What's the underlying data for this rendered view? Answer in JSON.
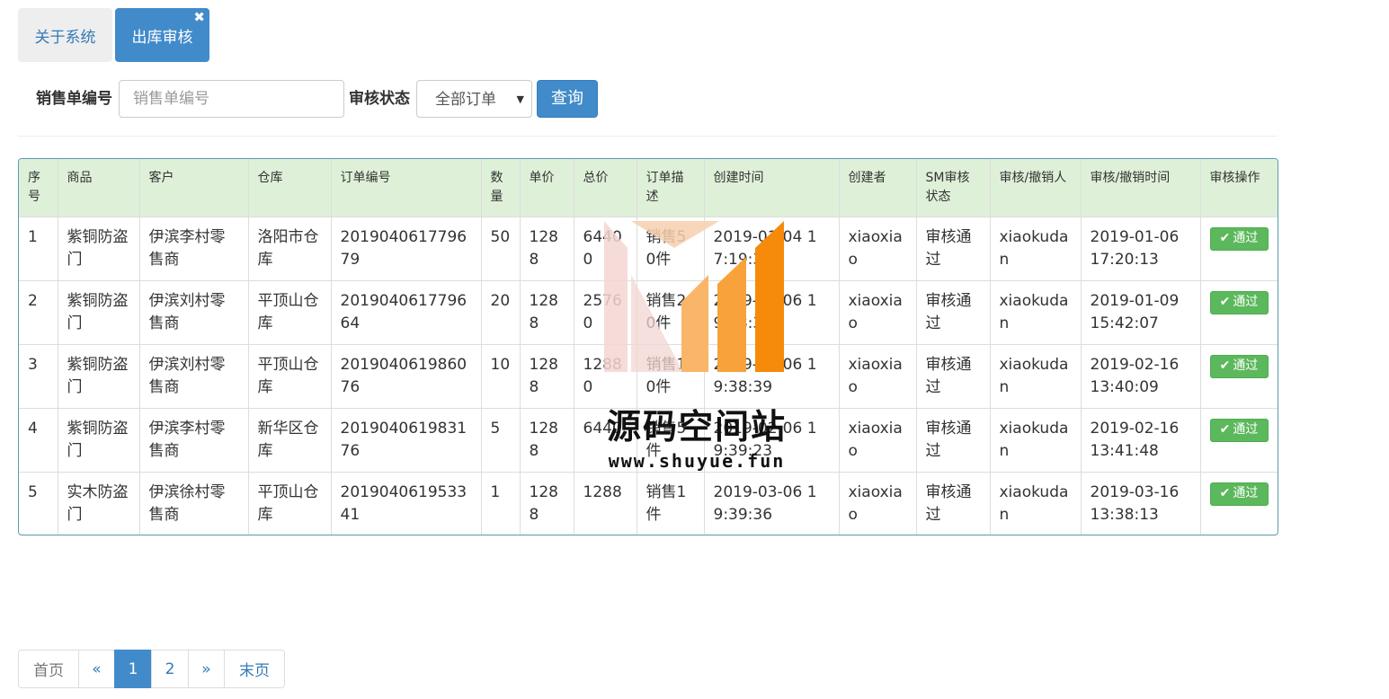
{
  "tabs": {
    "about": "关于系统",
    "active": "出库审核",
    "close": "✖"
  },
  "search": {
    "order_label": "销售单编号",
    "order_placeholder": "销售单编号",
    "status_label": "审核状态",
    "status_selected": "全部订单",
    "query_button": "查询"
  },
  "table": {
    "headers": [
      "序号",
      "商品",
      "客户",
      "仓库",
      "订单编号",
      "数量",
      "单价",
      "总价",
      "订单描述",
      "创建时间",
      "创建者",
      "SM审核状态",
      "审核/撤销人",
      "审核/撤销时间",
      "审核操作"
    ],
    "rows": [
      [
        "1",
        "紫铜防盗门",
        "伊滨李村零售商",
        "洛阳市仓库",
        "201904061779679",
        "50",
        "1288",
        "64400",
        "销售50件",
        "2019-01-04 17:19:39",
        "xiaoxiao",
        "审核通过",
        "xiaokudan",
        "2019-01-06 17:20:13"
      ],
      [
        "2",
        "紫铜防盗门",
        "伊滨刘村零售商",
        "平顶山仓库",
        "201904061779664",
        "20",
        "1288",
        "25760",
        "销售20件",
        "2019-01-06 19:38:39",
        "xiaoxiao",
        "审核通过",
        "xiaokudan",
        "2019-01-09 15:42:07"
      ],
      [
        "3",
        "紫铜防盗门",
        "伊滨刘村零售商",
        "平顶山仓库",
        "201904061986076",
        "10",
        "1288",
        "12880",
        "销售10件",
        "2019-02-06 19:38:39",
        "xiaoxiao",
        "审核通过",
        "xiaokudan",
        "2019-02-16 13:40:09"
      ],
      [
        "4",
        "紫铜防盗门",
        "伊滨李村零售商",
        "新华区仓库",
        "201904061983176",
        "5",
        "1288",
        "6440",
        "销售5件",
        "2019-02-06 19:39:23",
        "xiaoxiao",
        "审核通过",
        "xiaokudan",
        "2019-02-16 13:41:48"
      ],
      [
        "5",
        "实木防盗门",
        "伊滨徐村零售商",
        "平顶山仓库",
        "201904061953341",
        "1",
        "1288",
        "1288",
        "销售1件",
        "2019-03-06 19:39:36",
        "xiaoxiao",
        "审核通过",
        "xiaokudan",
        "2019-03-16 13:38:13"
      ]
    ],
    "pass_button": "通过"
  },
  "watermark": {
    "title": "源码空间站",
    "url": "www.shuyue.fun"
  },
  "pager": {
    "first": "首页",
    "prev": "«",
    "page1": "1",
    "page2": "2",
    "next": "»",
    "last": "末页"
  },
  "colors": {
    "primary": "#428bca",
    "success": "#5cb85c",
    "header_bg": "#dff0d8"
  }
}
